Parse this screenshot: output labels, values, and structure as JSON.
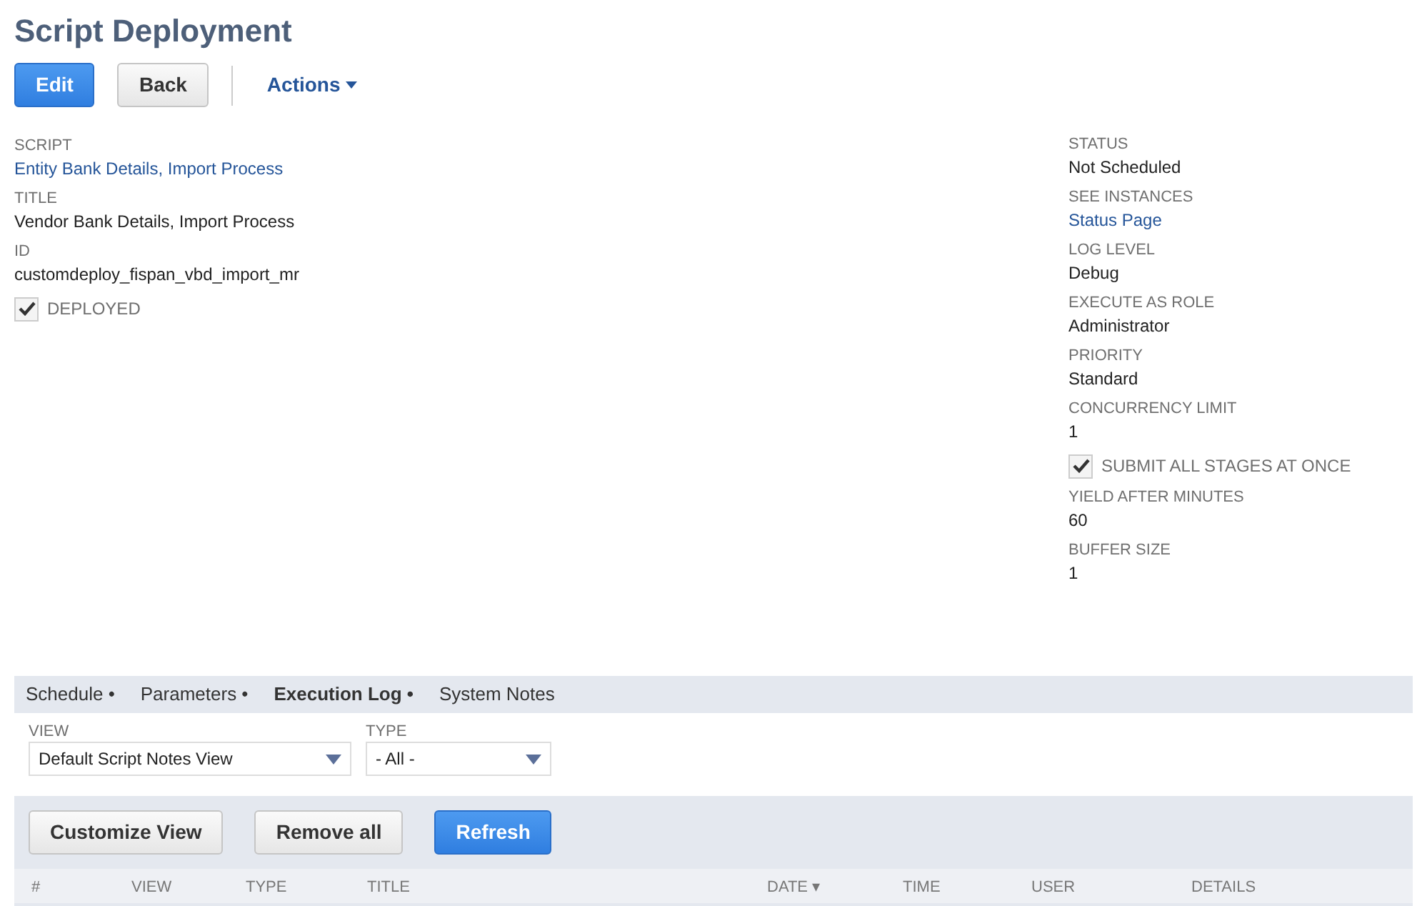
{
  "title": "Script Deployment",
  "buttons": [
    {
      "label": "Edit",
      "kind": "primary"
    },
    {
      "label": "Back",
      "kind": "secondary"
    }
  ],
  "actions": {
    "label": "Actions"
  },
  "left_fields": [
    {
      "kind": "text",
      "label": "SCRIPT",
      "value": "Entity Bank Details, Import Process",
      "link": true
    },
    {
      "kind": "text",
      "label": "TITLE",
      "value": "Vendor Bank Details, Import Process",
      "link": false
    },
    {
      "kind": "text",
      "label": "ID",
      "value": "customdeploy_fispan_vbd_import_mr",
      "link": false
    },
    {
      "kind": "checkbox",
      "label": "DEPLOYED",
      "checked": true
    }
  ],
  "right_fields": [
    {
      "kind": "text",
      "label": "STATUS",
      "value": "Not Scheduled",
      "link": false
    },
    {
      "kind": "text",
      "label": "SEE INSTANCES",
      "value": "Status Page",
      "link": true
    },
    {
      "kind": "text",
      "label": "LOG LEVEL",
      "value": "Debug",
      "link": false
    },
    {
      "kind": "text",
      "label": "EXECUTE AS ROLE",
      "value": "Administrator",
      "link": false
    },
    {
      "kind": "text",
      "label": "PRIORITY",
      "value": "Standard",
      "link": false
    },
    {
      "kind": "text",
      "label": "CONCURRENCY LIMIT",
      "value": "1",
      "link": false
    },
    {
      "kind": "checkbox",
      "label": "SUBMIT ALL STAGES AT ONCE",
      "checked": true
    },
    {
      "kind": "text",
      "label": "YIELD AFTER MINUTES",
      "value": "60",
      "link": false
    },
    {
      "kind": "text",
      "label": "BUFFER SIZE",
      "value": "1",
      "link": false
    }
  ],
  "tabs": [
    {
      "label": "Schedule •",
      "selected": false
    },
    {
      "label": "Parameters •",
      "selected": false
    },
    {
      "label": "Execution Log •",
      "selected": true
    },
    {
      "label": "System Notes",
      "selected": false
    }
  ],
  "filters": [
    {
      "label": "VIEW",
      "value": "Default Script Notes View"
    },
    {
      "label": "TYPE",
      "value": "- All -"
    }
  ],
  "list_buttons": [
    {
      "label": "Customize View",
      "kind": "secondary"
    },
    {
      "label": "Remove all",
      "kind": "secondary"
    },
    {
      "label": "Refresh",
      "kind": "primary"
    }
  ],
  "table": {
    "columns": [
      "#",
      "VIEW",
      "TYPE",
      "TITLE",
      "DATE ▾",
      "TIME",
      "USER",
      "DETAILS"
    ]
  }
}
